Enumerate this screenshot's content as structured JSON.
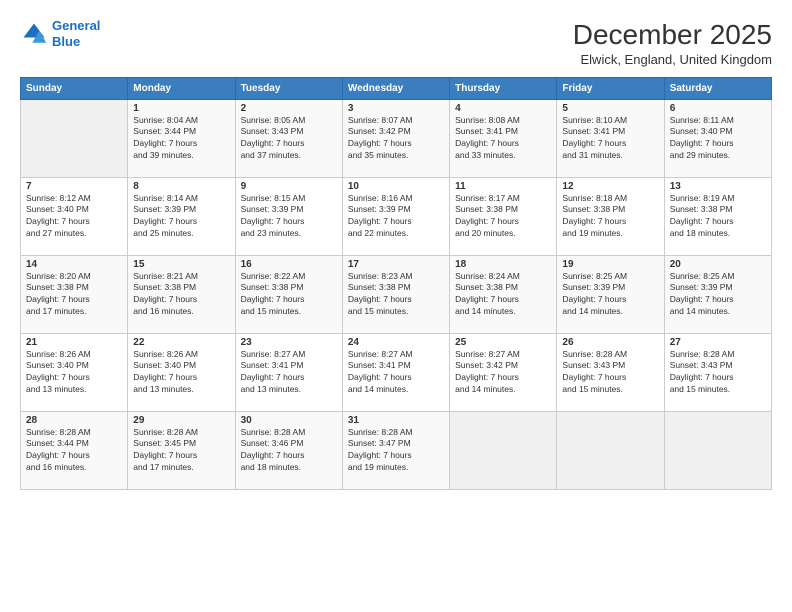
{
  "header": {
    "logo_line1": "General",
    "logo_line2": "Blue",
    "main_title": "December 2025",
    "subtitle": "Elwick, England, United Kingdom"
  },
  "days_of_week": [
    "Sunday",
    "Monday",
    "Tuesday",
    "Wednesday",
    "Thursday",
    "Friday",
    "Saturday"
  ],
  "weeks": [
    [
      {
        "day": "",
        "info": ""
      },
      {
        "day": "1",
        "info": "Sunrise: 8:04 AM\nSunset: 3:44 PM\nDaylight: 7 hours\nand 39 minutes."
      },
      {
        "day": "2",
        "info": "Sunrise: 8:05 AM\nSunset: 3:43 PM\nDaylight: 7 hours\nand 37 minutes."
      },
      {
        "day": "3",
        "info": "Sunrise: 8:07 AM\nSunset: 3:42 PM\nDaylight: 7 hours\nand 35 minutes."
      },
      {
        "day": "4",
        "info": "Sunrise: 8:08 AM\nSunset: 3:41 PM\nDaylight: 7 hours\nand 33 minutes."
      },
      {
        "day": "5",
        "info": "Sunrise: 8:10 AM\nSunset: 3:41 PM\nDaylight: 7 hours\nand 31 minutes."
      },
      {
        "day": "6",
        "info": "Sunrise: 8:11 AM\nSunset: 3:40 PM\nDaylight: 7 hours\nand 29 minutes."
      }
    ],
    [
      {
        "day": "7",
        "info": "Sunrise: 8:12 AM\nSunset: 3:40 PM\nDaylight: 7 hours\nand 27 minutes."
      },
      {
        "day": "8",
        "info": "Sunrise: 8:14 AM\nSunset: 3:39 PM\nDaylight: 7 hours\nand 25 minutes."
      },
      {
        "day": "9",
        "info": "Sunrise: 8:15 AM\nSunset: 3:39 PM\nDaylight: 7 hours\nand 23 minutes."
      },
      {
        "day": "10",
        "info": "Sunrise: 8:16 AM\nSunset: 3:39 PM\nDaylight: 7 hours\nand 22 minutes."
      },
      {
        "day": "11",
        "info": "Sunrise: 8:17 AM\nSunset: 3:38 PM\nDaylight: 7 hours\nand 20 minutes."
      },
      {
        "day": "12",
        "info": "Sunrise: 8:18 AM\nSunset: 3:38 PM\nDaylight: 7 hours\nand 19 minutes."
      },
      {
        "day": "13",
        "info": "Sunrise: 8:19 AM\nSunset: 3:38 PM\nDaylight: 7 hours\nand 18 minutes."
      }
    ],
    [
      {
        "day": "14",
        "info": "Sunrise: 8:20 AM\nSunset: 3:38 PM\nDaylight: 7 hours\nand 17 minutes."
      },
      {
        "day": "15",
        "info": "Sunrise: 8:21 AM\nSunset: 3:38 PM\nDaylight: 7 hours\nand 16 minutes."
      },
      {
        "day": "16",
        "info": "Sunrise: 8:22 AM\nSunset: 3:38 PM\nDaylight: 7 hours\nand 15 minutes."
      },
      {
        "day": "17",
        "info": "Sunrise: 8:23 AM\nSunset: 3:38 PM\nDaylight: 7 hours\nand 15 minutes."
      },
      {
        "day": "18",
        "info": "Sunrise: 8:24 AM\nSunset: 3:38 PM\nDaylight: 7 hours\nand 14 minutes."
      },
      {
        "day": "19",
        "info": "Sunrise: 8:25 AM\nSunset: 3:39 PM\nDaylight: 7 hours\nand 14 minutes."
      },
      {
        "day": "20",
        "info": "Sunrise: 8:25 AM\nSunset: 3:39 PM\nDaylight: 7 hours\nand 14 minutes."
      }
    ],
    [
      {
        "day": "21",
        "info": "Sunrise: 8:26 AM\nSunset: 3:40 PM\nDaylight: 7 hours\nand 13 minutes."
      },
      {
        "day": "22",
        "info": "Sunrise: 8:26 AM\nSunset: 3:40 PM\nDaylight: 7 hours\nand 13 minutes."
      },
      {
        "day": "23",
        "info": "Sunrise: 8:27 AM\nSunset: 3:41 PM\nDaylight: 7 hours\nand 13 minutes."
      },
      {
        "day": "24",
        "info": "Sunrise: 8:27 AM\nSunset: 3:41 PM\nDaylight: 7 hours\nand 14 minutes."
      },
      {
        "day": "25",
        "info": "Sunrise: 8:27 AM\nSunset: 3:42 PM\nDaylight: 7 hours\nand 14 minutes."
      },
      {
        "day": "26",
        "info": "Sunrise: 8:28 AM\nSunset: 3:43 PM\nDaylight: 7 hours\nand 15 minutes."
      },
      {
        "day": "27",
        "info": "Sunrise: 8:28 AM\nSunset: 3:43 PM\nDaylight: 7 hours\nand 15 minutes."
      }
    ],
    [
      {
        "day": "28",
        "info": "Sunrise: 8:28 AM\nSunset: 3:44 PM\nDaylight: 7 hours\nand 16 minutes."
      },
      {
        "day": "29",
        "info": "Sunrise: 8:28 AM\nSunset: 3:45 PM\nDaylight: 7 hours\nand 17 minutes."
      },
      {
        "day": "30",
        "info": "Sunrise: 8:28 AM\nSunset: 3:46 PM\nDaylight: 7 hours\nand 18 minutes."
      },
      {
        "day": "31",
        "info": "Sunrise: 8:28 AM\nSunset: 3:47 PM\nDaylight: 7 hours\nand 19 minutes."
      },
      {
        "day": "",
        "info": ""
      },
      {
        "day": "",
        "info": ""
      },
      {
        "day": "",
        "info": ""
      }
    ]
  ]
}
